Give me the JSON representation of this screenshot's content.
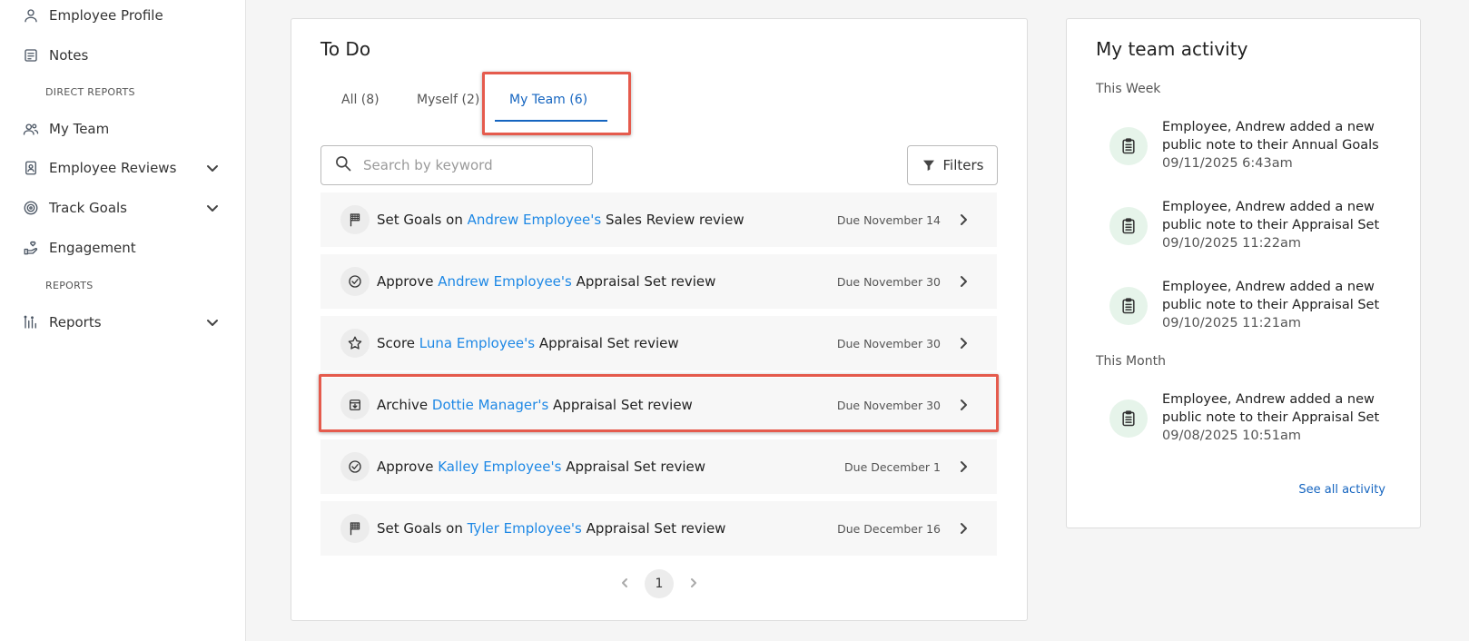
{
  "sidebar": {
    "items": [
      {
        "label": "Employee Profile",
        "icon": "person-icon"
      },
      {
        "label": "Notes",
        "icon": "notes-icon"
      },
      {
        "label": "My Team",
        "icon": "team-icon"
      },
      {
        "label": "Employee Reviews",
        "icon": "review-icon"
      },
      {
        "label": "Track Goals",
        "icon": "target-icon"
      },
      {
        "label": "Engagement",
        "icon": "engagement-icon"
      },
      {
        "label": "Reports",
        "icon": "reports-icon"
      }
    ],
    "section_direct_reports": "DIRECT REPORTS",
    "section_reports": "REPORTS"
  },
  "todo": {
    "title": "To Do",
    "tabs": [
      {
        "label": "All (8)"
      },
      {
        "label": "Myself (2)"
      },
      {
        "label": "My Team (6)"
      }
    ],
    "active_tab": "My Team (6)",
    "search_placeholder": "Search by keyword",
    "filters_label": "Filters",
    "tasks": [
      {
        "icon": "flag-icon",
        "action": "Set Goals on",
        "person": "Andrew Employee's",
        "rest": "Sales Review review",
        "due": "Due November 14"
      },
      {
        "icon": "check-circle-icon",
        "action": "Approve",
        "person": "Andrew Employee's",
        "rest": "Appraisal Set review",
        "due": "Due November 30"
      },
      {
        "icon": "star-icon",
        "action": "Score",
        "person": "Luna Employee's",
        "rest": "Appraisal Set review",
        "due": "Due November 30"
      },
      {
        "icon": "archive-icon",
        "action": "Archive",
        "person": "Dottie Manager's",
        "rest": "Appraisal Set review",
        "due": "Due November 30"
      },
      {
        "icon": "check-circle-icon",
        "action": "Approve",
        "person": "Kalley Employee's",
        "rest": "Appraisal Set review",
        "due": "Due December 1"
      },
      {
        "icon": "flag-icon",
        "action": "Set Goals on",
        "person": "Tyler Employee's",
        "rest": "Appraisal Set review",
        "due": "Due December 16"
      }
    ],
    "current_page": "1"
  },
  "activity": {
    "title": "My team activity",
    "group_this_week": "This Week",
    "group_this_month": "This Month",
    "items": [
      {
        "line1": "Employee, Andrew added a new",
        "line2": "public note to their Annual Goals",
        "time": "09/11/2025 6:43am"
      },
      {
        "line1": "Employee, Andrew added a new",
        "line2": "public note to their Appraisal Set",
        "time": "09/10/2025 11:22am"
      },
      {
        "line1": "Employee, Andrew added a new",
        "line2": "public note to their Appraisal Set",
        "time": "09/10/2025 11:21am"
      },
      {
        "line1": "Employee, Andrew added a new",
        "line2": "public note to their Appraisal Set",
        "time": "09/08/2025 10:51am"
      }
    ],
    "see_all": "See all activity"
  },
  "colors": {
    "accent": "#1565c0",
    "link": "#1e88e5",
    "highlight": "#e55b4d"
  }
}
